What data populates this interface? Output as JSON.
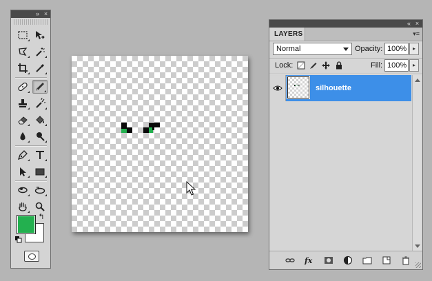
{
  "tools_panel": {
    "collapse_glyph": "»",
    "close_glyph": "×",
    "tools": [
      {
        "name": "rectangular-marquee-tool",
        "active": false
      },
      {
        "name": "move-tool",
        "active": false
      },
      {
        "name": "lasso-tool",
        "active": false
      },
      {
        "name": "magic-wand-tool",
        "active": false
      },
      {
        "name": "crop-tool",
        "active": false
      },
      {
        "name": "eyedropper-tool",
        "active": false
      },
      {
        "name": "healing-brush-tool",
        "active": false
      },
      {
        "name": "pencil-tool",
        "active": true
      },
      {
        "name": "clone-stamp-tool",
        "active": false
      },
      {
        "name": "history-brush-tool",
        "active": false
      },
      {
        "name": "eraser-tool",
        "active": false
      },
      {
        "name": "paint-bucket-tool",
        "active": false
      },
      {
        "name": "blur-tool",
        "active": false
      },
      {
        "name": "burn-tool",
        "active": false
      },
      {
        "name": "pen-tool",
        "active": false
      },
      {
        "name": "type-tool",
        "active": false
      },
      {
        "name": "path-selection-tool",
        "active": false
      },
      {
        "name": "rectangle-shape-tool",
        "active": false
      },
      {
        "name": "3d-rotate-tool",
        "active": false
      },
      {
        "name": "3d-orbit-tool",
        "active": false
      },
      {
        "name": "hand-tool",
        "active": false
      },
      {
        "name": "zoom-tool",
        "active": false
      }
    ],
    "foreground_color": "#23b04f",
    "background_color": "#ffffff",
    "swap_glyph": "↰"
  },
  "layers_panel": {
    "collapse_glyph": "«",
    "close_glyph": "×",
    "tab_label": "LAYERS",
    "menu_glyph": "▾≡",
    "blend_mode": "Normal",
    "opacity_label": "Opacity:",
    "opacity_value": "100%",
    "lock_label": "Lock:",
    "fill_label": "Fill:",
    "fill_value": "100%",
    "layers": [
      {
        "name": "silhouette",
        "visible": true,
        "selected": true
      }
    ],
    "selection_color": "#3d8fe8",
    "bottom_buttons": [
      "link-layers",
      "layer-style-fx",
      "add-mask",
      "adjustment-layer",
      "new-group",
      "new-layer",
      "delete-layer"
    ]
  },
  "canvas": {
    "pixel_colors": {
      "dark": "#0a0a0a",
      "green": "#23b04f"
    }
  }
}
